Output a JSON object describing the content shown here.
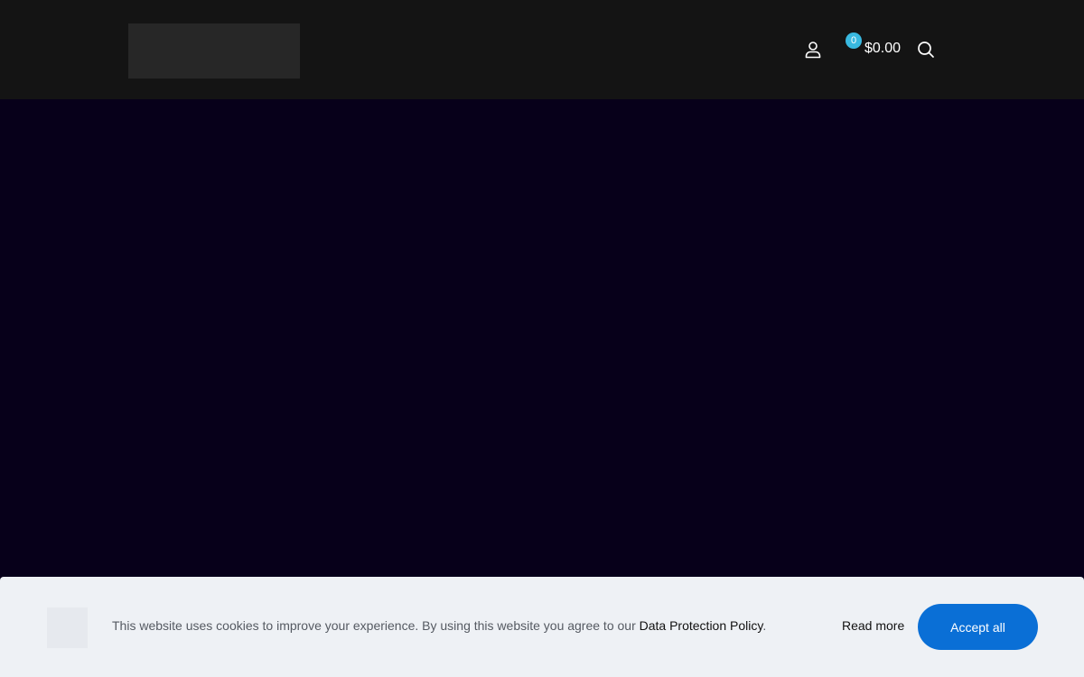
{
  "header": {
    "cart": {
      "count": "0",
      "total": "$0.00"
    },
    "icons": {
      "account": "user-icon",
      "search": "search-icon"
    }
  },
  "cookie_banner": {
    "message": "This website uses cookies to improve your experience. By using this website you agree to our ",
    "policy_link": "Data Protection Policy",
    "period": ".",
    "read_more": "Read more",
    "accept": "Accept all"
  },
  "colors": {
    "header_bg": "#141414",
    "hero_bg": "#07001a",
    "cart_badge": "#39b9e0",
    "accept_button": "#0a6fd6",
    "cookie_bg": "#eef1f5"
  }
}
